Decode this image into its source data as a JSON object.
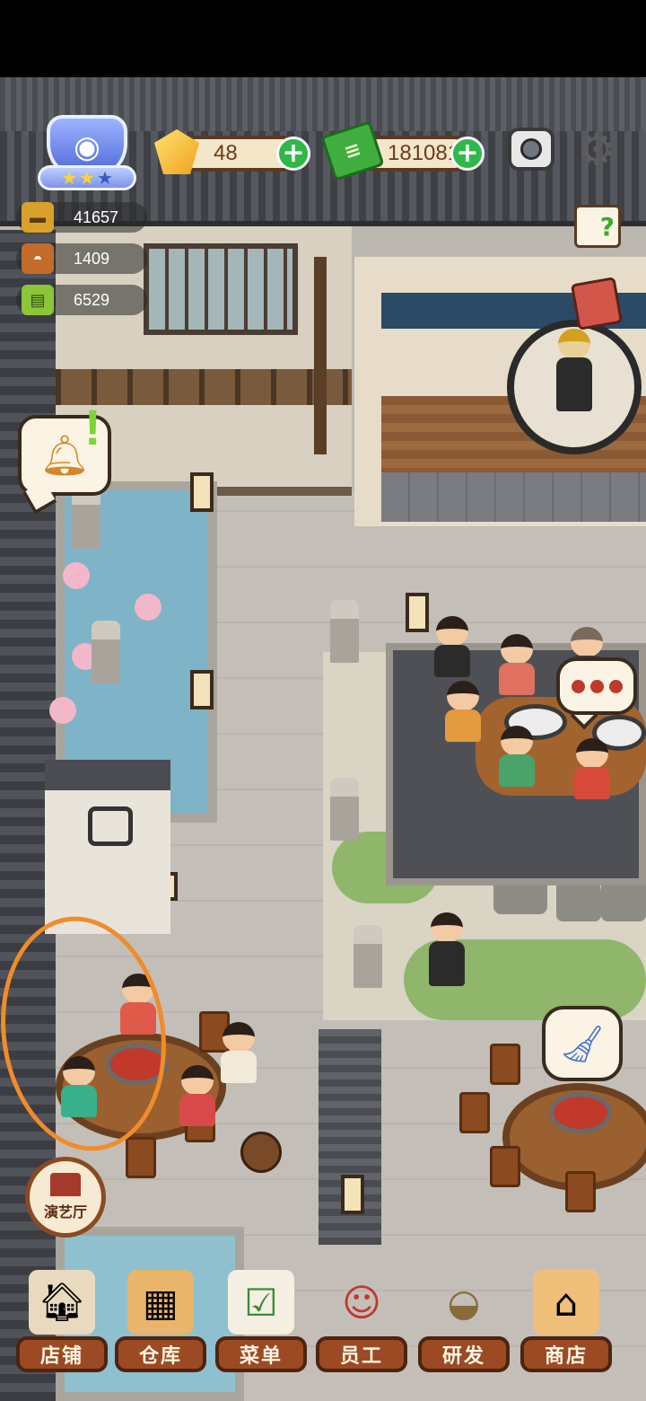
{
  "hud": {
    "rank": {
      "stars_filled": 2,
      "stars_total": 3,
      "icon": "bowl-icon"
    },
    "gems": {
      "value": "48",
      "icon": "gem-icon",
      "add_icon": "plus-icon"
    },
    "cash": {
      "value": "181081",
      "icon": "cash-icon",
      "add_icon": "plus-icon"
    },
    "stats": [
      {
        "value": "41657",
        "icon": "pot-icon"
      },
      {
        "value": "1409",
        "icon": "cloche-icon"
      },
      {
        "value": "6529",
        "icon": "recipe-book-icon"
      }
    ],
    "camera_icon": "camera-icon",
    "settings_icon": "gear-icon",
    "guide_icon": "guide-book-icon",
    "journal_icon": "journal-icon"
  },
  "bubbles": {
    "bell_icon": "bell-icon",
    "bell_mark": "!",
    "chat_icon": "chat-dots-icon",
    "clean_icon": "broom-icon"
  },
  "theater": {
    "label": "演艺厅",
    "icon": "theater-icon"
  },
  "bottom_nav": [
    {
      "label": "店铺",
      "icon": "shop-building-icon"
    },
    {
      "label": "仓库",
      "icon": "warehouse-boxes-icon"
    },
    {
      "label": "菜单",
      "icon": "menu-clipboard-icon"
    },
    {
      "label": "员工",
      "icon": "staff-chef-icon"
    },
    {
      "label": "研发",
      "icon": "research-wok-icon"
    },
    {
      "label": "商店",
      "icon": "store-stall-icon"
    }
  ],
  "colors": {
    "highlight": "#f08c2a",
    "nav_label_bg": "#9b4a24",
    "plus_button": "#2fb84a"
  }
}
